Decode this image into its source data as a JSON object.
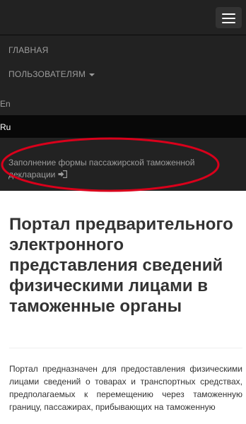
{
  "navbar": {
    "toggle_icon": "hamburger-icon"
  },
  "menu": {
    "home_label": "ГЛАВНАЯ",
    "users_label": "ПОЛЬЗОВАТЕЛЯМ",
    "users_caret_icon": "caret-down-icon",
    "lang_en": "En",
    "lang_ru": "Ru",
    "declaration_label": "Заполнение формы пассажирской таможенной декларации",
    "declaration_icon": "sign-in-icon"
  },
  "annotation": {
    "highlight_color": "#d9001b"
  },
  "main": {
    "title": "Портал предварительного электронного представления сведений физическими лицами в таможенные органы",
    "intro": "Портал предназначен для предоставления физическими лицами сведений о товарах и транспортных средствах, предполагаемых к перемещению через таможенную границу, пассажирах, прибывающих на таможенную"
  },
  "colors": {
    "navbar_bg": "#222222",
    "active_bg": "#080808",
    "nav_text": "#9d9d9d",
    "heading_text": "#333333"
  }
}
